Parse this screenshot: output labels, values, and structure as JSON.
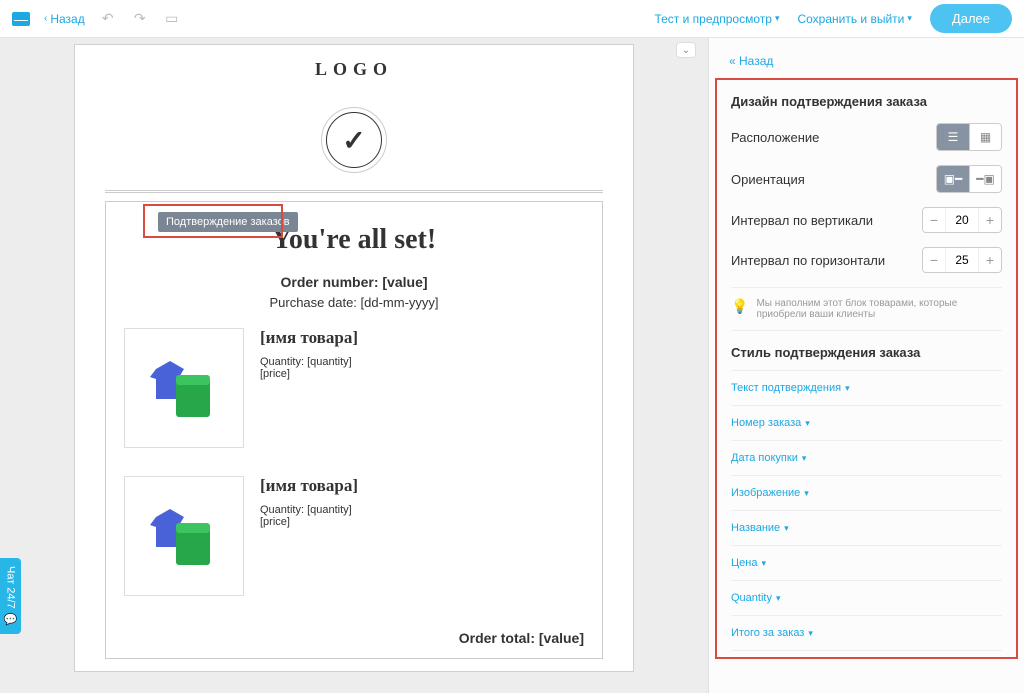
{
  "topbar": {
    "back": "Назад",
    "test_preview": "Тест и предпросмотр",
    "save_exit": "Сохранить и выйти",
    "next": "Далее"
  },
  "canvas": {
    "logo": "LOGO",
    "block_label": "Подтверждение заказов",
    "title": "You're all set!",
    "order_number": "Order number: [value]",
    "purchase_date": "Purchase date: [dd-mm-yyyy]",
    "items": [
      {
        "name": "[имя товара]",
        "qty": "Quantity: [quantity]",
        "price": "[price]"
      },
      {
        "name": "[имя товара]",
        "qty": "Quantity: [quantity]",
        "price": "[price]"
      }
    ],
    "order_total": "Order total: [value]"
  },
  "sidebar": {
    "back": "« Назад",
    "section_title": "Дизайн подтверждения заказа",
    "layout_label": "Расположение",
    "orientation_label": "Ориентация",
    "vinterval_label": "Интервал по вертикали",
    "vinterval_value": "20",
    "hinterval_label": "Интервал по горизонтали",
    "hinterval_value": "25",
    "hint": "Мы наполним этот блок товарами, которые приобрели ваши клиенты",
    "style_title": "Стиль подтверждения заказа",
    "accordion": [
      "Текст подтверждения",
      "Номер заказа",
      "Дата покупки",
      "Изображение",
      "Название",
      "Цена",
      "Quantity",
      "Итого за заказ"
    ]
  },
  "chat": "Чат 24/7"
}
